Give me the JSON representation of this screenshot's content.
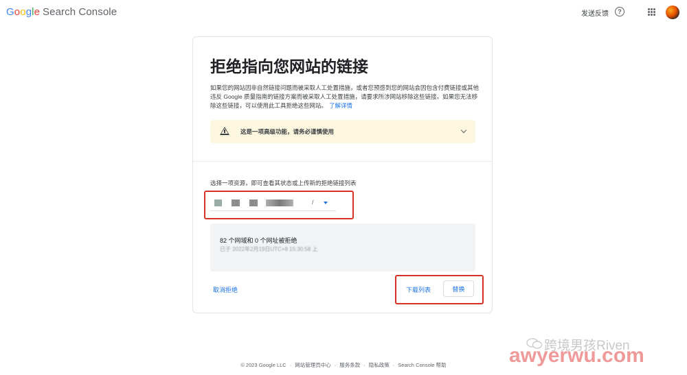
{
  "header": {
    "logo_google": [
      "G",
      "o",
      "o",
      "g",
      "l",
      "e"
    ],
    "logo_product": "Search Console",
    "feedback_label": "发送反馈",
    "help_icon": "help-circle-icon",
    "apps_icon": "apps-grid-icon",
    "avatar": "avatar"
  },
  "card": {
    "title": "拒绝指向您网站的链接",
    "description": "如果您的网站因非自然链接问题而被采取人工处置措施，或者您预感到您的网站会因包含付费链接或其他违反 Google 质量指南的链接方案而被采取人工处置措施，请要求所涉网站移除这些链接。如果您无法移除这些链接，可以使用此工具拒绝这些网站。",
    "learn_more": "了解详情",
    "warning": {
      "icon": "warning-triangle-icon",
      "text": "这是一项高级功能，请务必谨慎使用",
      "expand_icon": "chevron-down-icon"
    },
    "select_label": "选择一项资源，即可查看其状态或上传新的拒绝链接列表",
    "resource_select": {
      "value": "/",
      "arrow_icon": "dropdown-arrow-icon"
    },
    "status": {
      "main": "82 个网域和 0 个网址被拒绝",
      "sub": "已于 2022年2月19日UTC+8 15:30:58 上"
    },
    "undo_label": "取消拒绝",
    "download_label": "下载列表",
    "replace_label": "替换"
  },
  "footer": {
    "items": [
      "© 2023 Google LLC",
      "网站管理员中心",
      "服务条款",
      "隐私政策",
      "Search Console 帮助"
    ]
  },
  "watermark": {
    "line1": "跨境男孩Riven",
    "line2": "awyerwu.com"
  },
  "colors": {
    "accent": "#1a73e8",
    "warning_bg": "#fef7e0",
    "highlight": "#d93025"
  }
}
